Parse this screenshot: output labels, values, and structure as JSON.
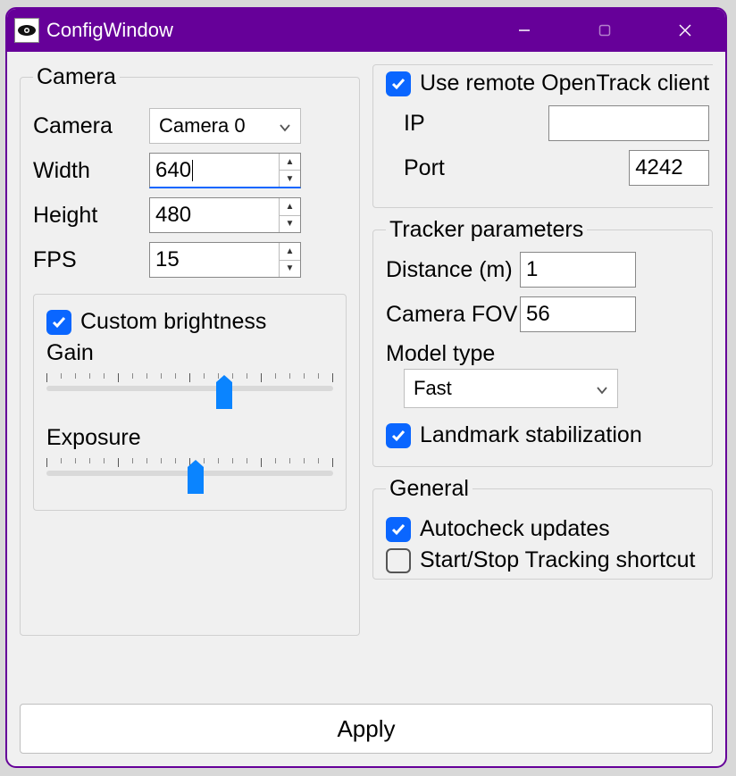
{
  "window": {
    "title": "ConfigWindow"
  },
  "camera_group": {
    "legend": "Camera",
    "camera_label": "Camera",
    "camera_value": "Camera 0",
    "width_label": "Width",
    "width_value": "640",
    "height_label": "Height",
    "height_value": "480",
    "fps_label": "FPS",
    "fps_value": "15",
    "custom_brightness_label": "Custom brightness",
    "custom_brightness_checked": true,
    "gain_label": "Gain",
    "gain_value_pct": 62,
    "exposure_label": "Exposure",
    "exposure_value_pct": 52
  },
  "remote_group": {
    "use_remote_label": "Use remote OpenTrack client",
    "use_remote_checked": true,
    "ip_label": "IP",
    "ip_value": "",
    "port_label": "Port",
    "port_value": "4242"
  },
  "tracker_group": {
    "legend": "Tracker parameters",
    "distance_label": "Distance (m)",
    "distance_value": "1",
    "fov_label": "Camera FOV",
    "fov_value": "56",
    "model_type_label": "Model type",
    "model_type_value": "Fast",
    "landmark_stab_label": "Landmark stabilization",
    "landmark_stab_checked": true
  },
  "general_group": {
    "legend": "General",
    "autocheck_label": "Autocheck updates",
    "autocheck_checked": true,
    "shortcut_label": "Start/Stop Tracking shortcut",
    "shortcut_checked": false
  },
  "apply_label": "Apply"
}
